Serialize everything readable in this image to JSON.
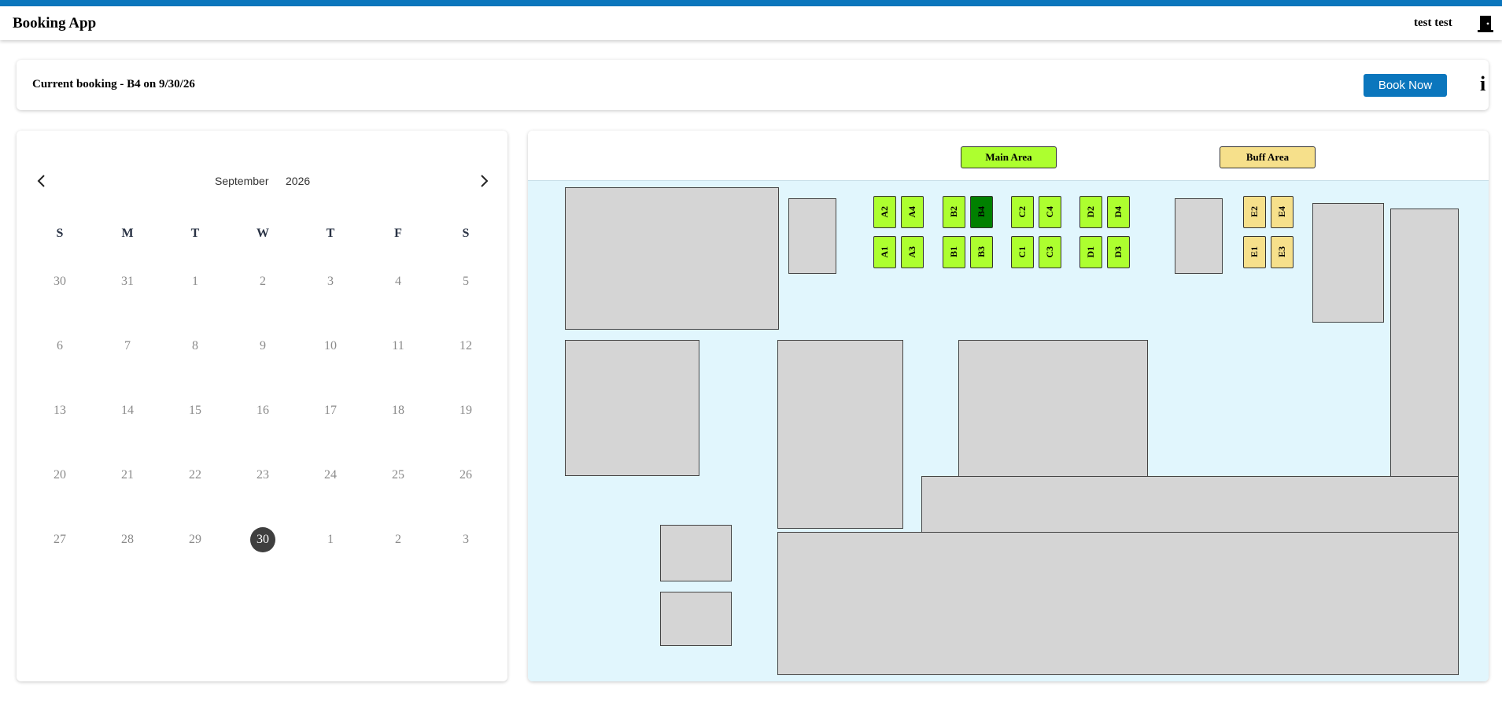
{
  "header": {
    "app_title": "Booking App",
    "user_name": "test test",
    "logout_icon": "door-exit-icon"
  },
  "booking": {
    "current_text": "Current booking - B4 on 9/30/26",
    "book_button": "Book Now",
    "info_label": "i"
  },
  "calendar": {
    "month": "September",
    "year": "2026",
    "weekdays": [
      "S",
      "M",
      "T",
      "W",
      "T",
      "F",
      "S"
    ],
    "weeks": [
      [
        "30",
        "31",
        "1",
        "2",
        "3",
        "4",
        "5"
      ],
      [
        "6",
        "7",
        "8",
        "9",
        "10",
        "11",
        "12"
      ],
      [
        "13",
        "14",
        "15",
        "16",
        "17",
        "18",
        "19"
      ],
      [
        "20",
        "21",
        "22",
        "23",
        "24",
        "25",
        "26"
      ],
      [
        "27",
        "28",
        "29",
        "30",
        "1",
        "2",
        "3"
      ]
    ],
    "selected_day": "30"
  },
  "map": {
    "legend": {
      "main_area": "Main Area",
      "buff_area": "Buff Area"
    },
    "colors": {
      "main": "#adff2f",
      "buff": "#f6e08b",
      "booked": "#008000",
      "floor": "#e1f6fd",
      "room": "#d5d5d5"
    },
    "desks": {
      "A2": "A2",
      "A4": "A4",
      "A1": "A1",
      "A3": "A3",
      "B2": "B2",
      "B4": "B4",
      "B1": "B1",
      "B3": "B3",
      "C2": "C2",
      "C4": "C4",
      "C1": "C1",
      "C3": "C3",
      "D2": "D2",
      "D4": "D4",
      "D1": "D1",
      "D3": "D3",
      "E2": "E2",
      "E4": "E4",
      "E1": "E1",
      "E3": "E3"
    },
    "booked_desk": "B4"
  }
}
